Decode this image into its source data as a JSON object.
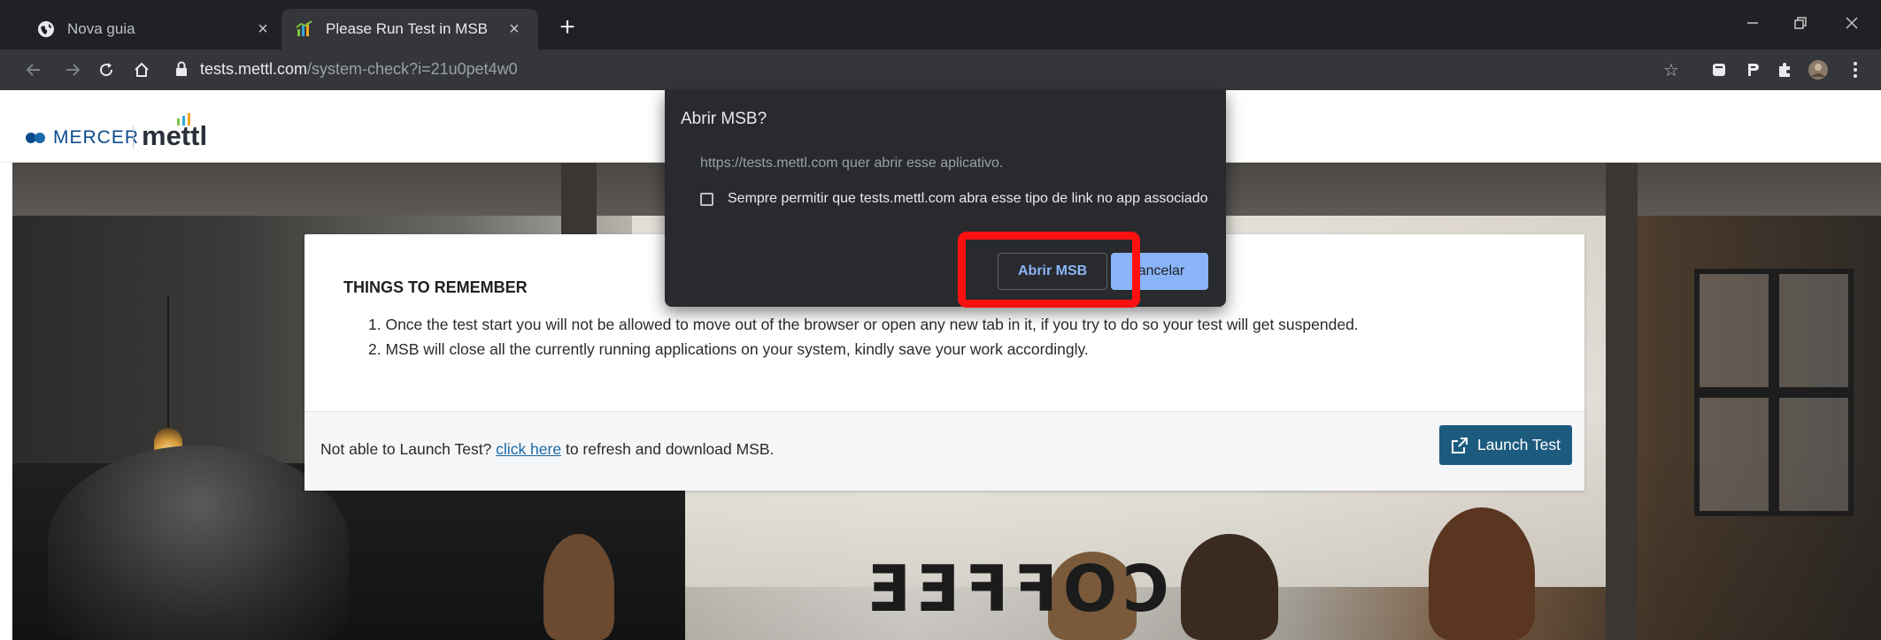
{
  "browser": {
    "tabs": [
      {
        "title": "Nova guia",
        "favicon": "globe-icon",
        "active": false
      },
      {
        "title": "Please Run Test in MSB",
        "favicon": "mettl-chart-icon",
        "active": true
      }
    ],
    "new_tab_label": "+",
    "url_host": "tests.mettl.com",
    "url_path": "/system-check?i=21u0pet4w0"
  },
  "site": {
    "logo_mercer": "MERCER",
    "logo_mettl": "mettl"
  },
  "card": {
    "title": "THINGS TO REMEMBER",
    "rules": [
      "1. Once the test start you will not be allowed to move out of the browser or open any new tab in it, if you try to do so your test will get suspended.",
      "2. MSB will close all the currently running applications on your system, kindly save your work accordingly."
    ],
    "footer_prefix": "Not able to Launch Test?",
    "footer_link": "click here",
    "footer_suffix": "to refresh and download MSB.",
    "launch_label": "Launch Test"
  },
  "dialog": {
    "title": "Abrir MSB?",
    "message": "https://tests.mettl.com quer abrir esse aplicativo.",
    "checkbox_label": "Sempre permitir que tests.mettl.com abra esse tipo de link no app associado",
    "checkbox_checked": false,
    "open_label": "Abrir MSB",
    "cancel_label": "ancelar"
  },
  "photo": {
    "sign_text": "COFFEE"
  },
  "colors": {
    "chrome_dark": "#202124",
    "toolbar": "#35363a",
    "accent_blue": "#8ab4f8",
    "launch_button": "#1d5b7e",
    "highlight": "#ff1010"
  }
}
